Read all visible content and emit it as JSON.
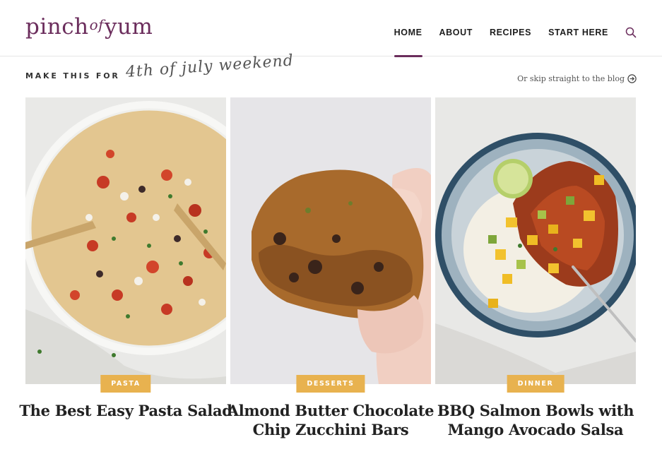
{
  "brand": {
    "logo_pre": "pinch",
    "logo_of": "of",
    "logo_post": "yum"
  },
  "nav": {
    "items": [
      {
        "label": "HOME",
        "active": true
      },
      {
        "label": "ABOUT",
        "active": false
      },
      {
        "label": "RECIPES",
        "active": false
      },
      {
        "label": "START HERE",
        "active": false
      }
    ],
    "search_icon": "search-icon"
  },
  "subheader": {
    "make_this_for": "MAKE THIS FOR",
    "occasion": "4th of july weekend",
    "skip_text": "Or skip straight to the blog",
    "skip_icon": "arrow-right-circle-icon"
  },
  "colors": {
    "brand": "#6b2d5c",
    "badge": "#e8b24f",
    "divider": "#e6e6e6"
  },
  "cards": [
    {
      "category": "PASTA",
      "title": "The Best Easy Pasta Salad"
    },
    {
      "category": "DESSERTS",
      "title": "Almond Butter Chocolate Chip Zucchini Bars"
    },
    {
      "category": "DINNER",
      "title": "BBQ Salmon Bowls with Mango Avocado Salsa"
    }
  ]
}
